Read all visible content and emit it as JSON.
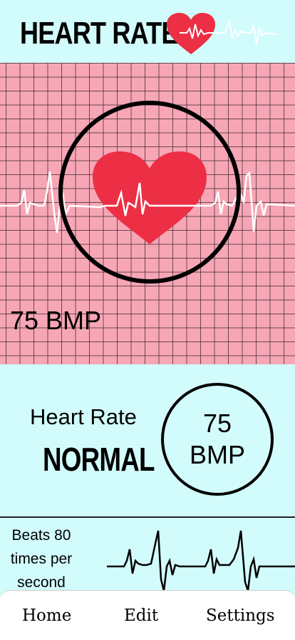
{
  "header": {
    "title": "HEART RATE",
    "icon": "heart-pulse-icon"
  },
  "monitor": {
    "bpm_display": "75 BMP",
    "icon": "heart-icon"
  },
  "status": {
    "label": "Heart Rate",
    "value": "NORMAL",
    "bpm_number": "75",
    "bpm_unit": "BMP"
  },
  "beats": {
    "line1": "Beats 80",
    "line2": "times per",
    "line3": "second"
  },
  "nav": {
    "items": [
      {
        "label": "Home"
      },
      {
        "label": "Edit"
      },
      {
        "label": "Settings"
      }
    ]
  },
  "colors": {
    "background": "#d2fbfc",
    "monitor_pink": "#f7a6b6",
    "heart_red": "#ec2f44"
  }
}
